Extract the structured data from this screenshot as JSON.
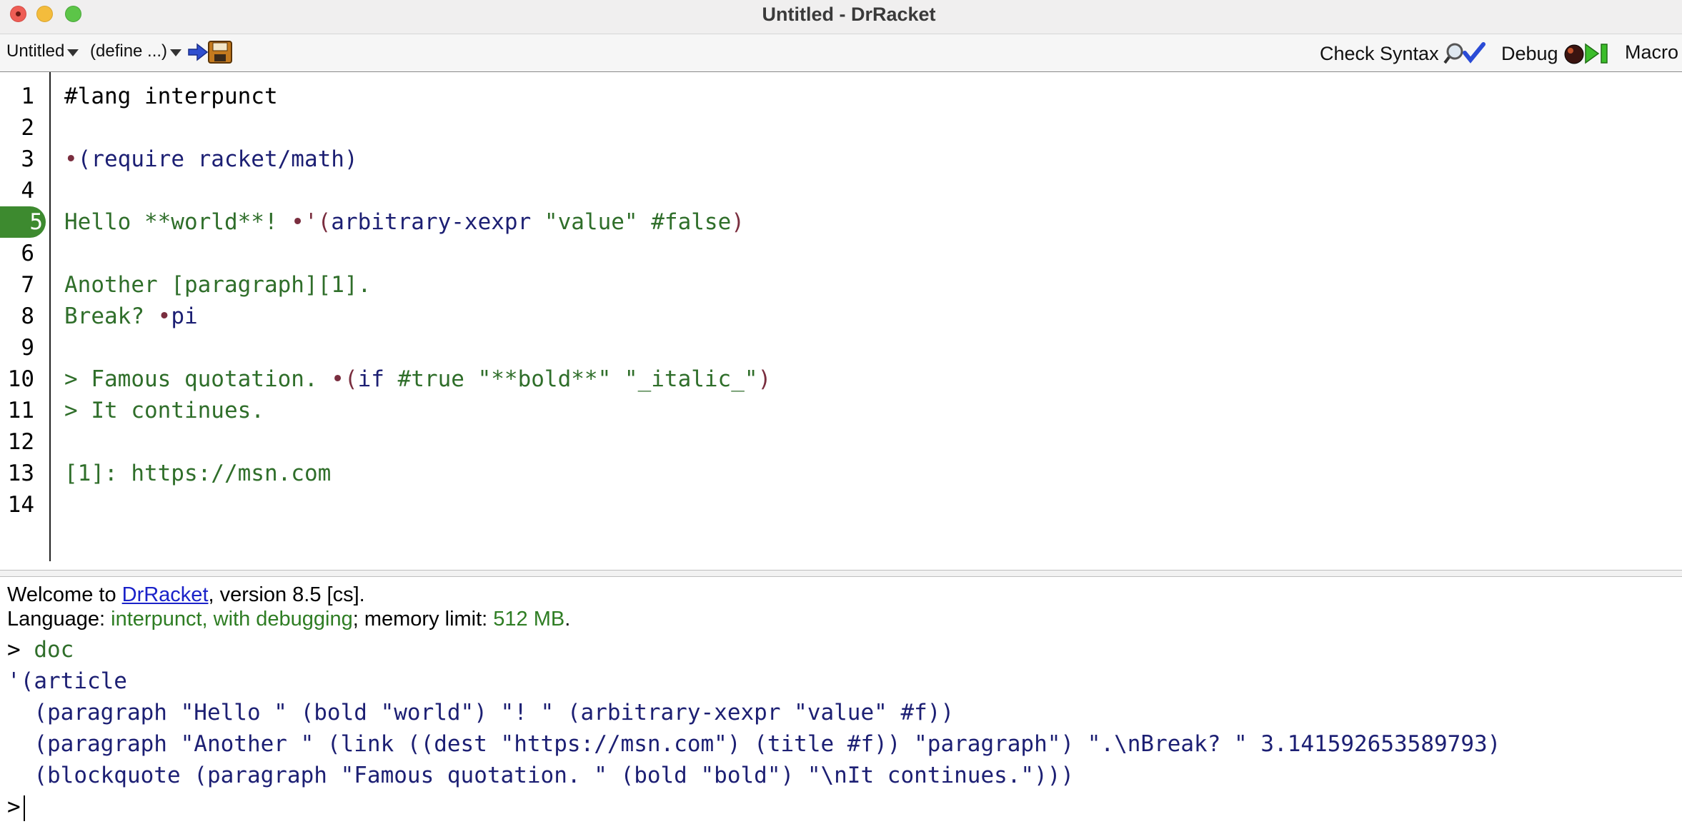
{
  "window": {
    "title": "Untitled - DrRacket"
  },
  "toolbar": {
    "file_menu": "Untitled",
    "define_menu": "(define ...)",
    "check_syntax": "Check Syntax",
    "debug": "Debug",
    "macro": "Macro"
  },
  "editor": {
    "line_numbers": [
      "1",
      "2",
      "3",
      "4",
      "5",
      "6",
      "7",
      "8",
      "9",
      "10",
      "11",
      "12",
      "13",
      "14"
    ],
    "current_line": "5",
    "lines": {
      "l1": "#lang interpunct",
      "l3_dot": "•",
      "l3_code": "(require racket/math)",
      "l5_text": "Hello **world**! ",
      "l5_dot": "•",
      "l5_quote": "'",
      "l5_code_open": "(",
      "l5_code_id": "arbitrary-xexpr",
      "l5_code_str": " \"value\" ",
      "l5_code_bool": "#false",
      "l5_code_close": ")",
      "l7": "Another [paragraph][1].",
      "l8_text": "Break? ",
      "l8_dot": "•",
      "l8_code": "pi",
      "l10_text": "> Famous quotation. ",
      "l10_dot": "•",
      "l10_open": "(",
      "l10_if": "if",
      "l10_true": " #true ",
      "l10_str1": "\"**bold**\"",
      "l10_str2": " \"_italic_\"",
      "l10_close": ")",
      "l11": "> It continues.",
      "l13": "[1]: https://msn.com"
    }
  },
  "repl": {
    "welcome_prefix": "Welcome to ",
    "welcome_link": "DrRacket",
    "welcome_suffix": ", version 8.5 [cs].",
    "language_prefix": "Language: ",
    "language_name": "interpunct, with debugging",
    "memory_prefix": "; memory limit: ",
    "memory_value": "512 MB",
    "memory_suffix": ".",
    "prompt": ">",
    "input": "doc",
    "output": [
      "'(article",
      "  (paragraph \"Hello \" (bold \"world\") \"! \" (arbitrary-xexpr \"value\" #f))",
      "  (paragraph \"Another \" (link ((dest \"https://msn.com\") (title #f)) \"paragraph\") \".\\nBreak? \" 3.141592653589793)",
      "  (blockquote (paragraph \"Famous quotation. \" (bold \"bold\") \"\\nIt continues.\")))"
    ],
    "final_prompt": ">"
  }
}
